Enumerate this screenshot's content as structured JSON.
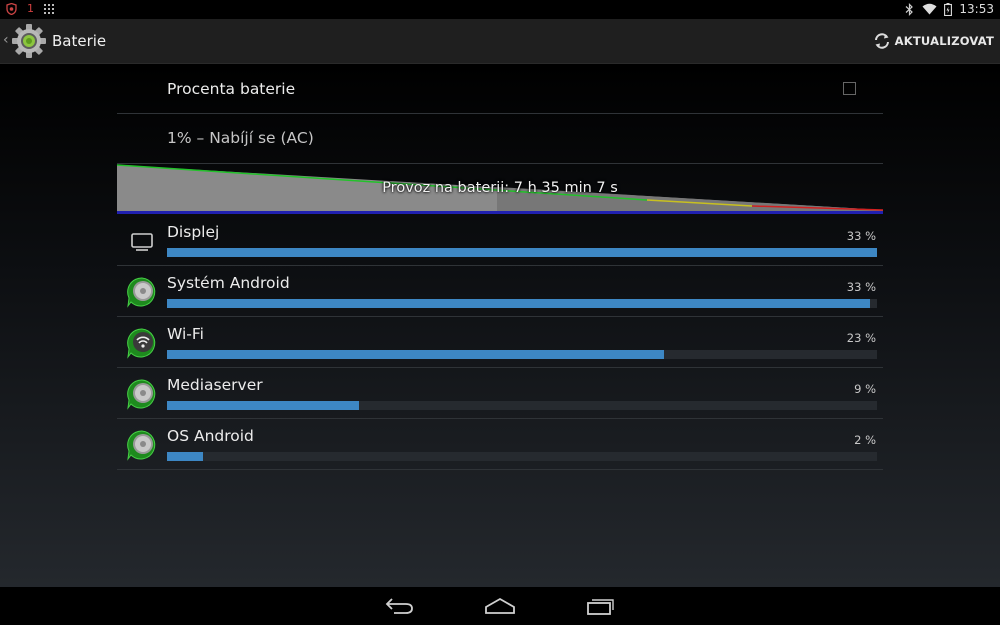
{
  "status_bar": {
    "notification_count": "1",
    "time": "13:53",
    "icons": [
      "shield-notification-icon",
      "grid-notification-icon",
      "bluetooth-icon",
      "wifi-icon",
      "battery-icon"
    ]
  },
  "action_bar": {
    "title": "Baterie",
    "refresh_label": "AKTUALIZOVAT"
  },
  "settings": {
    "battery_percent_label": "Procenta baterie",
    "battery_percent_checked": false,
    "status": "1% – Nabíjí se (AC)",
    "graph_label": "Provoz na baterii: 7 h 35 min 7 s"
  },
  "usage": [
    {
      "name": "Displej",
      "percent": "33 %",
      "fill": 1.0,
      "icon": "display-icon"
    },
    {
      "name": "Systém Android",
      "percent": "33 %",
      "fill": 0.99,
      "icon": "android-system-icon"
    },
    {
      "name": "Wi-Fi",
      "percent": "23 %",
      "fill": 0.7,
      "icon": "wifi-app-icon"
    },
    {
      "name": "Mediaserver",
      "percent": "9 %",
      "fill": 0.27,
      "icon": "mediaserver-icon"
    },
    {
      "name": "OS Android",
      "percent": "2 %",
      "fill": 0.05,
      "icon": "android-os-icon"
    }
  ],
  "colors": {
    "bar_fill": "#3d87c4",
    "bar_track": "#262a2f",
    "graph_green": "#22c22a",
    "graph_red": "#d02020",
    "graph_blue": "#2020b0"
  }
}
